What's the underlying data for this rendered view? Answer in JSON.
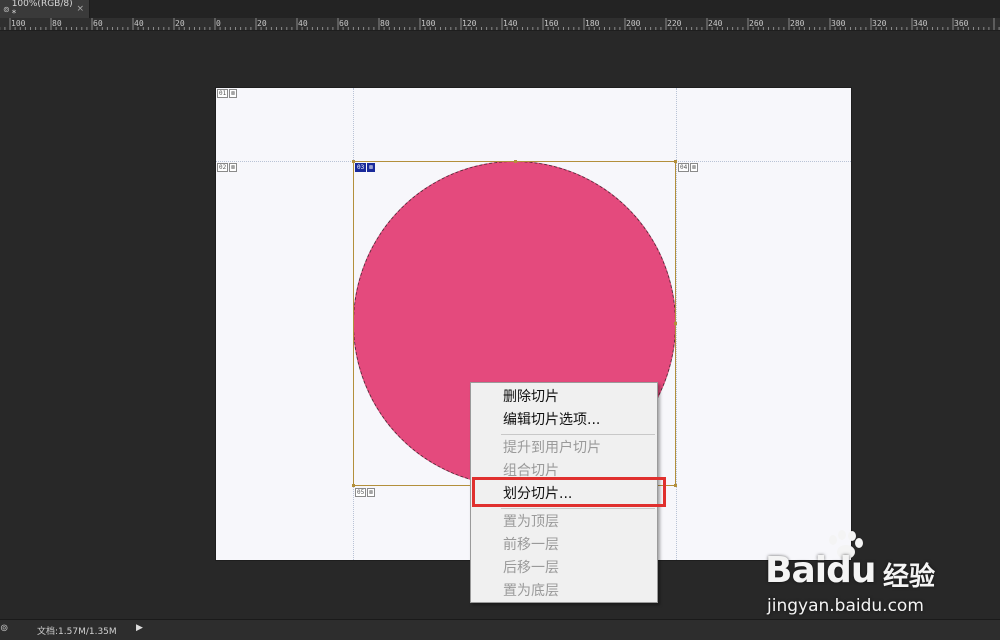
{
  "document_tab": {
    "title": "100%(RGB/8) *",
    "close_label": "×",
    "icon": "ps-document-icon"
  },
  "ruler": {
    "labels": [
      "100",
      "80",
      "60",
      "40",
      "20",
      "0",
      "20",
      "40",
      "60",
      "80",
      "100",
      "120",
      "140",
      "160",
      "180",
      "200",
      "220",
      "240",
      "260",
      "280",
      "300",
      "320",
      "340",
      "360"
    ]
  },
  "slices": {
    "tags": [
      {
        "id": "01",
        "label": [
          "01",
          "⊠"
        ]
      },
      {
        "id": "02",
        "label": [
          "02",
          "⊠"
        ]
      },
      {
        "id": "03",
        "label": [
          "03",
          "⊠"
        ]
      },
      {
        "id": "04",
        "label": [
          "04",
          "⊠"
        ]
      },
      {
        "id": "05",
        "label": [
          "05",
          "⊠"
        ]
      }
    ],
    "circle_color": "#e44a7d"
  },
  "context_menu": {
    "items": [
      {
        "label": "删除切片",
        "enabled": true
      },
      {
        "label": "编辑切片选项...",
        "enabled": true
      },
      {
        "label": "提升到用户切片",
        "enabled": false
      },
      {
        "label": "组合切片",
        "enabled": false
      },
      {
        "label": "划分切片...",
        "enabled": true,
        "highlighted": true
      },
      {
        "label": "置为顶层",
        "enabled": false
      },
      {
        "label": "前移一层",
        "enabled": false
      },
      {
        "label": "后移一层",
        "enabled": false
      },
      {
        "label": "置为底层",
        "enabled": false
      }
    ],
    "highlight_color": "#e0302e"
  },
  "status_bar": {
    "doc_info": "文档:1.57M/1.35M",
    "arrow": "▶",
    "icon": "zoom-icon"
  },
  "watermark": {
    "brand": "Bai",
    "brand_tail": "du",
    "product": "经验",
    "url": "jingyan.baidu.com"
  }
}
